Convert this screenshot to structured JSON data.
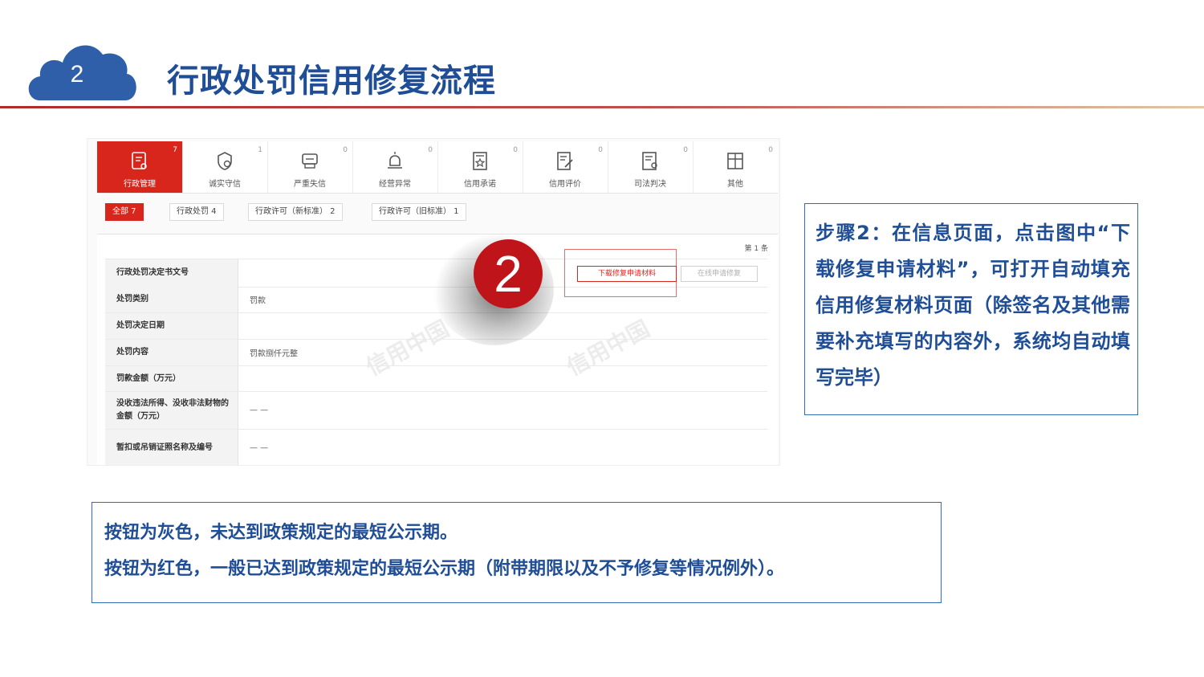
{
  "header": {
    "step_number": "2",
    "title": "行政处罚信用修复流程"
  },
  "screenshot": {
    "tabs": [
      {
        "label": "行政管理",
        "count": "7",
        "icon": "document-person-icon",
        "active": true
      },
      {
        "label": "诚实守信",
        "count": "1",
        "icon": "shield-badge-icon",
        "active": false
      },
      {
        "label": "严重失信",
        "count": "0",
        "icon": "alert-stack-icon",
        "active": false
      },
      {
        "label": "经营异常",
        "count": "0",
        "icon": "warning-siren-icon",
        "active": false
      },
      {
        "label": "信用承诺",
        "count": "0",
        "icon": "star-certificate-icon",
        "active": false
      },
      {
        "label": "信用评价",
        "count": "0",
        "icon": "edit-document-icon",
        "active": false
      },
      {
        "label": "司法判决",
        "count": "0",
        "icon": "judgment-document-icon",
        "active": false
      },
      {
        "label": "其他",
        "count": "0",
        "icon": "layout-document-icon",
        "active": false
      }
    ],
    "filters": [
      {
        "label": "全部  7",
        "active": true
      },
      {
        "label": "行政处罚  4",
        "active": false
      },
      {
        "label": "行政许可（新标准）  2",
        "active": false
      },
      {
        "label": "行政许可（旧标准）  1",
        "active": false
      }
    ],
    "page_count": "第 1 条",
    "rows": [
      {
        "label": "行政处罚决定书文号",
        "value": ""
      },
      {
        "label": "处罚类别",
        "value": "罚款"
      },
      {
        "label": "处罚决定日期",
        "value": ""
      },
      {
        "label": "处罚内容",
        "value": "罚款捌仟元整"
      },
      {
        "label": "罚款金额（万元）",
        "value": ""
      },
      {
        "label": "没收违法所得、没收非法财物的金额（万元）",
        "value": "— —"
      },
      {
        "label": "暂扣或吊销证照名称及编号",
        "value": "— —"
      }
    ],
    "download_button": "下载修复申请材料",
    "online_button": "在线申请修复",
    "watermark": "信用中国",
    "step_badge": "2"
  },
  "step_text": "步骤2：在信息页面，点击图中“下载修复申请材料”，可打开自动填充信用修复材料页面（除签名及其他需要补充填写的内容外，系统均自动填写完毕）",
  "notes": {
    "line1": "按钮为灰色，未达到政策规定的最短公示期。",
    "line2": "按钮为红色，一般已达到政策规定的最短公示期（附带期限以及不予修复等情况例外）。"
  },
  "colors": {
    "title_blue": "#1f4e96",
    "cloud_blue": "#2e5fa8",
    "accent_red": "#d9261c",
    "badge_red": "#c0141b",
    "box_border": "#2e6eb5"
  }
}
